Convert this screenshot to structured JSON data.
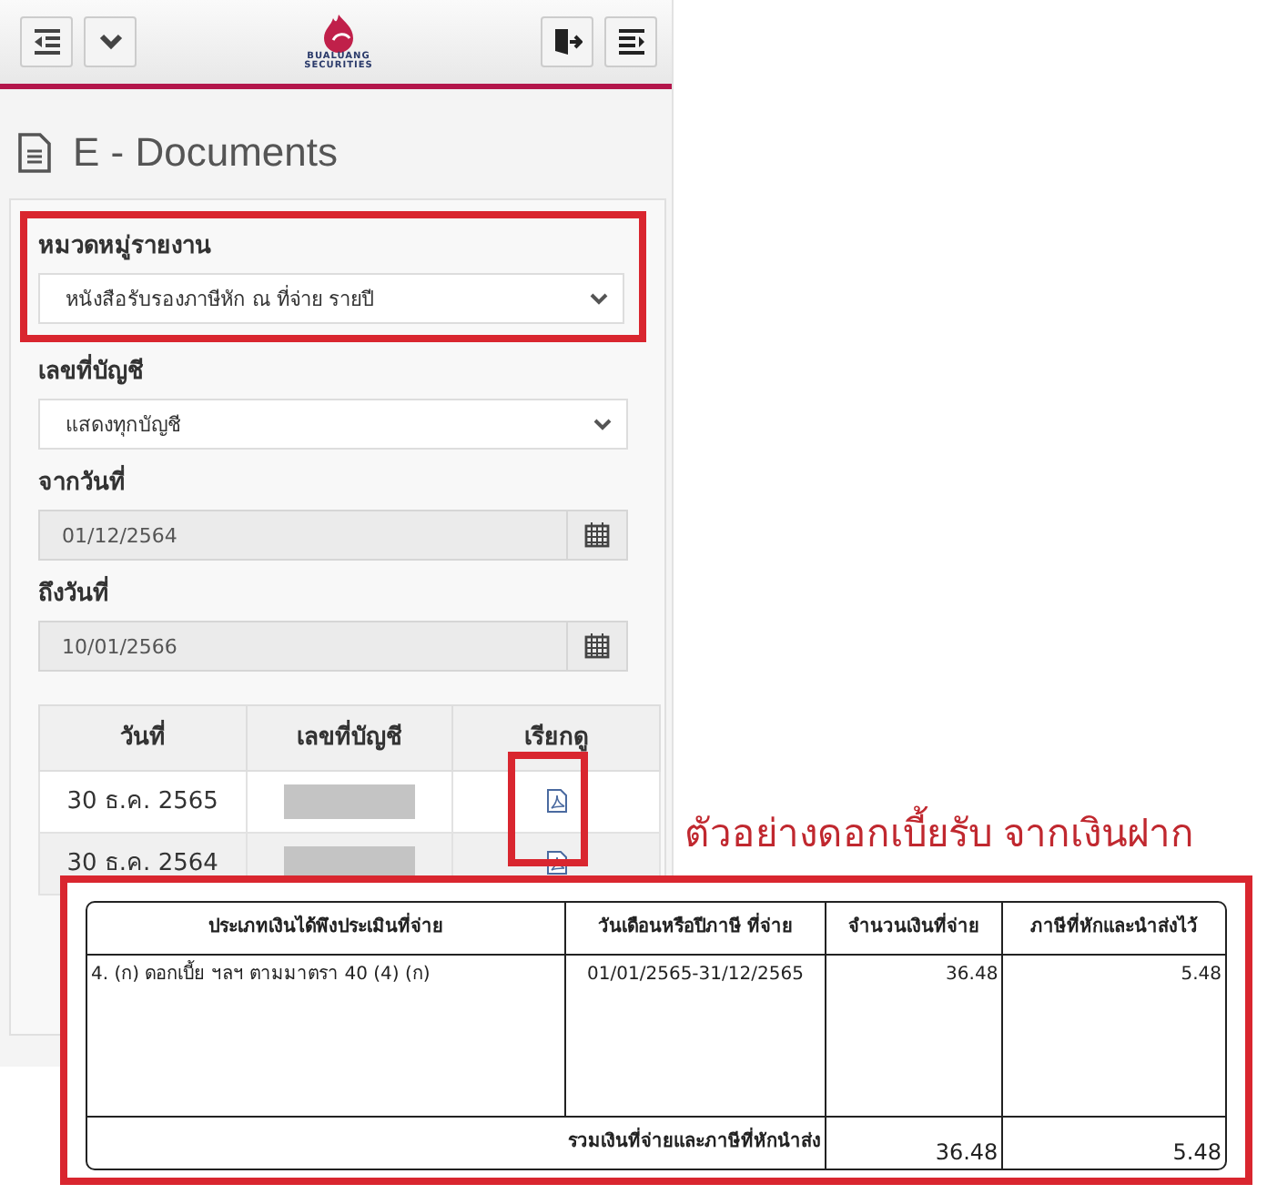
{
  "logo": {
    "name": "BUALUANG",
    "subtitle": "SECURITIES"
  },
  "page_title": "E - Documents",
  "form": {
    "fields": [
      {
        "kind": "select",
        "label": "หมวดหมู่รายงาน",
        "value": "หนังสือรับรองภาษีหัก ณ ที่จ่าย รายปี",
        "highlighted": true
      },
      {
        "kind": "select",
        "label": "เลขที่บัญชี",
        "value": "แสดงทุกบัญชี",
        "highlighted": false
      },
      {
        "kind": "date",
        "label": "จากวันที่",
        "value": "01/12/2564",
        "highlighted": false
      },
      {
        "kind": "date",
        "label": "ถึงวันที่",
        "value": "10/01/2566",
        "highlighted": false
      }
    ]
  },
  "documents": {
    "columns": [
      "วันที่",
      "เลขที่บัญชี",
      "เรียกดู"
    ],
    "rows": [
      {
        "date": "30 ธ.ค. 2565"
      },
      {
        "date": "30 ธ.ค. 2564"
      }
    ]
  },
  "example_caption": "ตัวอย่างดอกเบี้ยรับ จากเงินฝาก",
  "example_table": {
    "columns": [
      "ประเภทเงินได้พึงประเมินที่จ่าย",
      "วันเดือนหรือปีภาษี ที่จ่าย",
      "จำนวนเงินที่จ่าย",
      "ภาษีที่หักและนำส่งไว้"
    ],
    "rows": [
      {
        "type": "4. (ก) ดอกเบี้ย ฯลฯ ตามมาตรา 40 (4) (ก)",
        "period": "01/01/2565-31/12/2565",
        "amount": "36.48",
        "tax": "5.48"
      }
    ],
    "total": {
      "label": "รวมเงินที่จ่ายและภาษีที่หักนำส่ง",
      "amount": "36.48",
      "tax": "5.48"
    }
  }
}
